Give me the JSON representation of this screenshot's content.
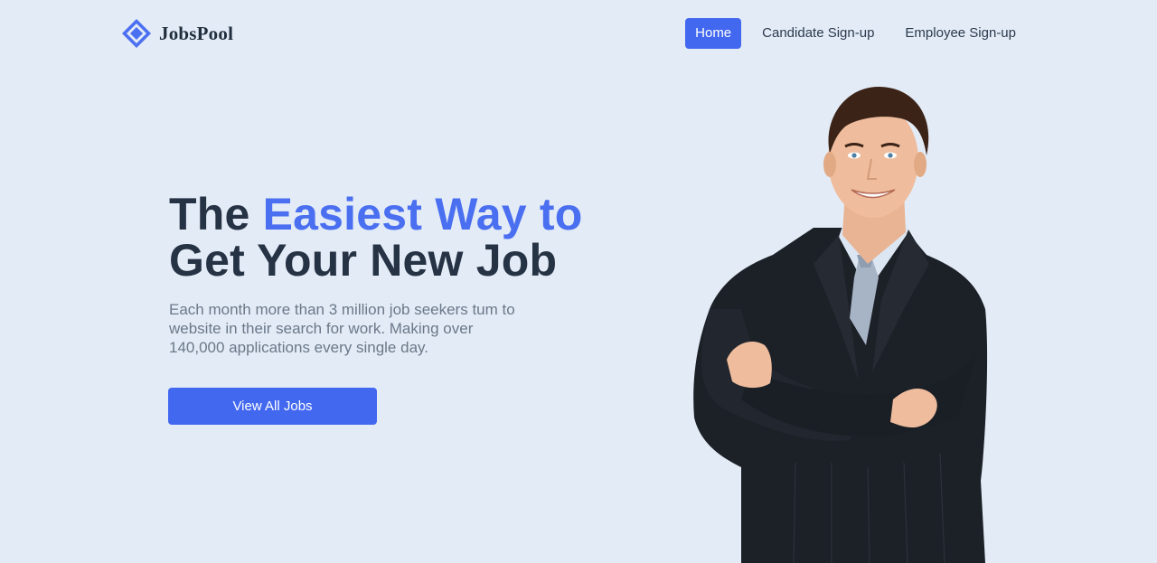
{
  "brand": {
    "name": "JobsPool",
    "logo_icon": "diamond-logo-icon",
    "color": "#4a6ff0"
  },
  "nav": {
    "items": [
      {
        "label": "Home",
        "active": true
      },
      {
        "label": "Candidate Sign-up",
        "active": false
      },
      {
        "label": "Employee Sign-up",
        "active": false
      }
    ]
  },
  "hero": {
    "title_line1_plain": "The",
    "title_line1_accent": "Easiest Way to",
    "title_line2": "Get Your New Job",
    "description": "Each month more than 3 million job seekers tum to website in their search for work. Making over 140,000 applications every single day.",
    "cta_label": "View All Jobs"
  },
  "colors": {
    "accent": "#4368f0",
    "background": "#e3ebf6",
    "heading": "#263345",
    "body_text": "#6b7889"
  }
}
